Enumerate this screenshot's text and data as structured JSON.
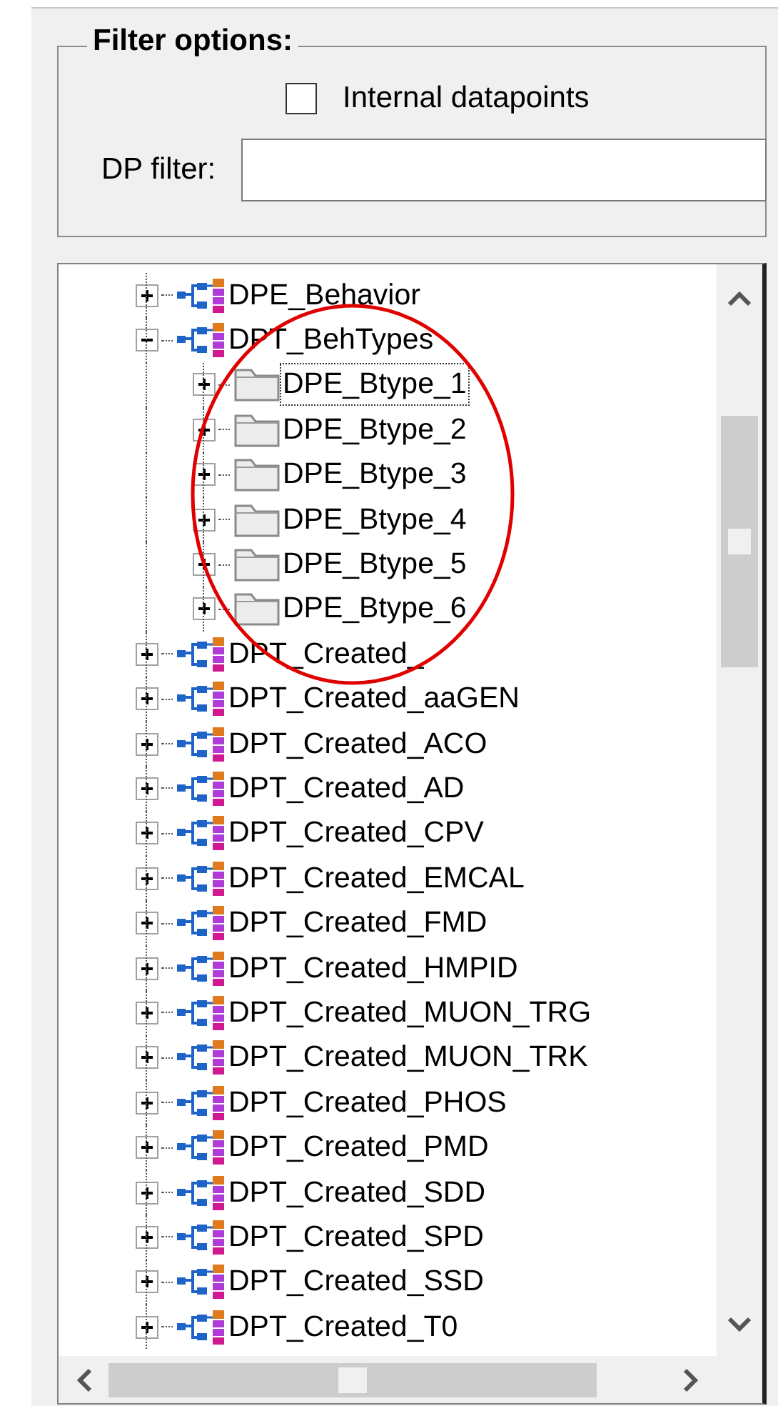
{
  "filter_options": {
    "title": "Filter options:",
    "internal_datapoints": {
      "label": "Internal datapoints",
      "checked": false
    },
    "dp_filter": {
      "label": "DP filter:"
    }
  },
  "tree": {
    "items": [
      {
        "label": "DPE_Behavior",
        "kind": "dpt",
        "expanded": false,
        "selected": false
      },
      {
        "label": "DPT_BehTypes",
        "kind": "dpt",
        "expanded": true,
        "selected": false,
        "children": [
          {
            "label": "DPE_Btype_1",
            "kind": "folder",
            "expanded": false,
            "selected": true
          },
          {
            "label": "DPE_Btype_2",
            "kind": "folder",
            "expanded": false,
            "selected": false
          },
          {
            "label": "DPE_Btype_3",
            "kind": "folder",
            "expanded": false,
            "selected": false
          },
          {
            "label": "DPE_Btype_4",
            "kind": "folder",
            "expanded": false,
            "selected": false
          },
          {
            "label": "DPE_Btype_5",
            "kind": "folder",
            "expanded": false,
            "selected": false
          },
          {
            "label": "DPE_Btype_6",
            "kind": "folder",
            "expanded": false,
            "selected": false
          }
        ]
      },
      {
        "label": "DPT_Created_",
        "kind": "dpt",
        "expanded": false,
        "selected": false
      },
      {
        "label": "DPT_Created_aaGEN",
        "kind": "dpt",
        "expanded": false,
        "selected": false
      },
      {
        "label": "DPT_Created_ACO",
        "kind": "dpt",
        "expanded": false,
        "selected": false
      },
      {
        "label": "DPT_Created_AD",
        "kind": "dpt",
        "expanded": false,
        "selected": false
      },
      {
        "label": "DPT_Created_CPV",
        "kind": "dpt",
        "expanded": false,
        "selected": false
      },
      {
        "label": "DPT_Created_EMCAL",
        "kind": "dpt",
        "expanded": false,
        "selected": false
      },
      {
        "label": "DPT_Created_FMD",
        "kind": "dpt",
        "expanded": false,
        "selected": false
      },
      {
        "label": "DPT_Created_HMPID",
        "kind": "dpt",
        "expanded": false,
        "selected": false
      },
      {
        "label": "DPT_Created_MUON_TRG",
        "kind": "dpt",
        "expanded": false,
        "selected": false
      },
      {
        "label": "DPT_Created_MUON_TRK",
        "kind": "dpt",
        "expanded": false,
        "selected": false
      },
      {
        "label": "DPT_Created_PHOS",
        "kind": "dpt",
        "expanded": false,
        "selected": false
      },
      {
        "label": "DPT_Created_PMD",
        "kind": "dpt",
        "expanded": false,
        "selected": false
      },
      {
        "label": "DPT_Created_SDD",
        "kind": "dpt",
        "expanded": false,
        "selected": false
      },
      {
        "label": "DPT_Created_SPD",
        "kind": "dpt",
        "expanded": false,
        "selected": false
      },
      {
        "label": "DPT_Created_SSD",
        "kind": "dpt",
        "expanded": false,
        "selected": false
      },
      {
        "label": "DPT_Created_T0",
        "kind": "dpt",
        "expanded": false,
        "selected": false
      }
    ]
  }
}
